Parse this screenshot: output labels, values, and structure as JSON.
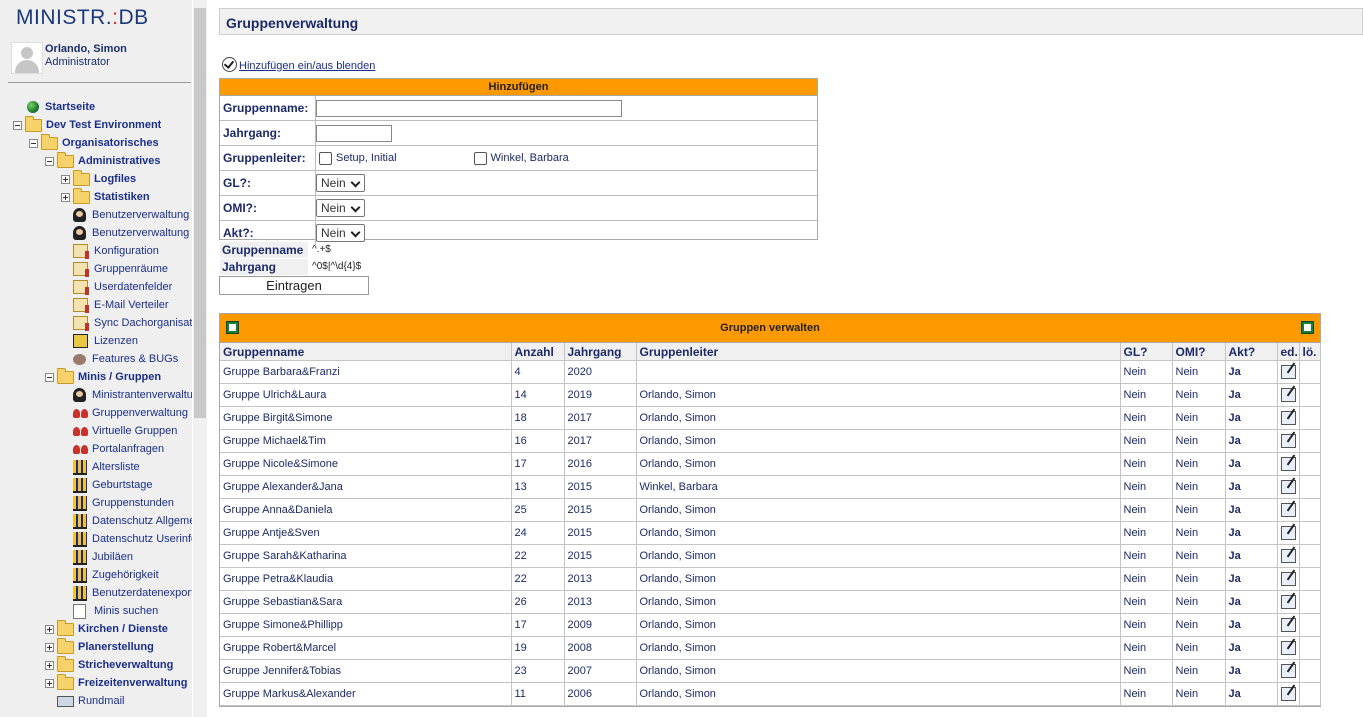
{
  "app": {
    "logo_text": "MINISTR.",
    "logo_accent": ":",
    "logo_suffix": "DB"
  },
  "user": {
    "name": "Orlando, Simon",
    "role": "Administrator"
  },
  "colors": {
    "accent": "#ff9900",
    "link": "#1a2f8a",
    "heading": "#1c2a6a"
  },
  "nav": [
    {
      "label": "Startseite",
      "indent": 0,
      "icon": "globe-icon",
      "bold": true,
      "expander": "none"
    },
    {
      "label": "Dev Test Environment",
      "indent": 0,
      "icon": "folder-icon",
      "bold": true,
      "expander": "minus"
    },
    {
      "label": "Organisatorisches",
      "indent": 1,
      "icon": "folder-icon",
      "bold": true,
      "expander": "minus"
    },
    {
      "label": "Administratives",
      "indent": 2,
      "icon": "folder-icon",
      "bold": true,
      "expander": "minus"
    },
    {
      "label": "Logfiles",
      "indent": 3,
      "icon": "folder-icon",
      "bold": true,
      "expander": "plus"
    },
    {
      "label": "Statistiken",
      "indent": 3,
      "icon": "folder-icon",
      "bold": true,
      "expander": "plus"
    },
    {
      "label": "Benutzerverwaltung",
      "indent": 3,
      "icon": "user-admin-icon",
      "bold": false,
      "expander": "none"
    },
    {
      "label": "Benutzerverwaltung",
      "indent": 3,
      "icon": "user-admin-icon",
      "bold": false,
      "expander": "none"
    },
    {
      "label": "Konfiguration",
      "indent": 3,
      "icon": "tools-icon",
      "bold": false,
      "expander": "none"
    },
    {
      "label": "Gruppenräume",
      "indent": 3,
      "icon": "tools-icon",
      "bold": false,
      "expander": "none"
    },
    {
      "label": "Userdatenfelder",
      "indent": 3,
      "icon": "tools-icon",
      "bold": false,
      "expander": "none"
    },
    {
      "label": "E-Mail Verteiler",
      "indent": 3,
      "icon": "tools-icon",
      "bold": false,
      "expander": "none"
    },
    {
      "label": "Sync Dachorganisation",
      "indent": 3,
      "icon": "tools-icon",
      "bold": false,
      "expander": "none"
    },
    {
      "label": "Lizenzen",
      "indent": 3,
      "icon": "key-icon",
      "bold": false,
      "expander": "none"
    },
    {
      "label": "Features & BUGs",
      "indent": 3,
      "icon": "bug-icon",
      "bold": false,
      "expander": "none"
    },
    {
      "label": "Minis / Gruppen",
      "indent": 2,
      "icon": "folder-icon",
      "bold": true,
      "expander": "minus"
    },
    {
      "label": "Ministrantenverwaltung",
      "indent": 3,
      "icon": "user-admin-icon",
      "bold": false,
      "expander": "none"
    },
    {
      "label": "Gruppenverwaltung",
      "indent": 3,
      "icon": "group-icon",
      "bold": false,
      "expander": "none"
    },
    {
      "label": "Virtuelle Gruppen",
      "indent": 3,
      "icon": "group-icon",
      "bold": false,
      "expander": "none"
    },
    {
      "label": "Portalanfragen",
      "indent": 3,
      "icon": "group-icon",
      "bold": false,
      "expander": "none"
    },
    {
      "label": "Altersliste",
      "indent": 3,
      "icon": "chart-icon",
      "bold": false,
      "expander": "none"
    },
    {
      "label": "Geburtstage",
      "indent": 3,
      "icon": "chart-icon",
      "bold": false,
      "expander": "none"
    },
    {
      "label": "Gruppenstunden",
      "indent": 3,
      "icon": "chart-icon",
      "bold": false,
      "expander": "none"
    },
    {
      "label": "Datenschutz Allgemein",
      "indent": 3,
      "icon": "chart-icon",
      "bold": false,
      "expander": "none"
    },
    {
      "label": "Datenschutz Userinfo",
      "indent": 3,
      "icon": "chart-icon",
      "bold": false,
      "expander": "none"
    },
    {
      "label": "Jubiläen",
      "indent": 3,
      "icon": "chart-icon",
      "bold": false,
      "expander": "none"
    },
    {
      "label": "Zugehörigkeit",
      "indent": 3,
      "icon": "chart-icon",
      "bold": false,
      "expander": "none"
    },
    {
      "label": "Benutzerdatenexport",
      "indent": 3,
      "icon": "chart-icon",
      "bold": false,
      "expander": "none"
    },
    {
      "label": "Minis suchen",
      "indent": 3,
      "icon": "search-doc-icon",
      "bold": false,
      "expander": "none"
    },
    {
      "label": "Kirchen / Dienste",
      "indent": 2,
      "icon": "folder-icon",
      "bold": true,
      "expander": "plus"
    },
    {
      "label": "Planerstellung",
      "indent": 2,
      "icon": "folder-icon",
      "bold": true,
      "expander": "plus"
    },
    {
      "label": "Stricheverwaltung",
      "indent": 2,
      "icon": "folder-icon",
      "bold": true,
      "expander": "plus"
    },
    {
      "label": "Freizeitenverwaltung",
      "indent": 2,
      "icon": "folder-icon",
      "bold": true,
      "expander": "plus"
    },
    {
      "label": "Rundmail",
      "indent": 2,
      "icon": "mail-icon",
      "bold": false,
      "expander": "none"
    }
  ],
  "page": {
    "title": "Gruppenverwaltung",
    "toggle_link": "Hinzufügen ein/aus blenden"
  },
  "add_form": {
    "header": "Hinzufügen",
    "fields": {
      "gruppenname": {
        "label": "Gruppenname:",
        "value": ""
      },
      "jahrgang": {
        "label": "Jahrgang:",
        "value": ""
      },
      "gruppenleiter": {
        "label": "Gruppenleiter:",
        "options": [
          "Setup, Initial",
          "Winkel, Barbara"
        ]
      },
      "gl": {
        "label": "GL?:",
        "value": "Nein"
      },
      "omi": {
        "label": "OMI?:",
        "value": "Nein"
      },
      "akt": {
        "label": "Akt?:",
        "value": "Nein"
      }
    },
    "hints": [
      {
        "label": "Gruppenname",
        "pattern": "^.+$"
      },
      {
        "label": "Jahrgang",
        "pattern": "^0$|^\\d{4}$"
      }
    ],
    "submit_label": "Eintragen"
  },
  "groups_table": {
    "title": "Gruppen verwalten",
    "columns": [
      "Gruppenname",
      "Anzahl",
      "Jahrgang",
      "Gruppenleiter",
      "GL?",
      "OMI?",
      "Akt?",
      "ed.",
      "lö."
    ],
    "rows": [
      [
        "Gruppe Barbara&Franzi",
        "4",
        "2020",
        "",
        "Nein",
        "Nein",
        "Ja"
      ],
      [
        "Gruppe Ulrich&Laura",
        "14",
        "2019",
        "Orlando, Simon",
        "Nein",
        "Nein",
        "Ja"
      ],
      [
        "Gruppe Birgit&Simone",
        "18",
        "2017",
        "Orlando, Simon",
        "Nein",
        "Nein",
        "Ja"
      ],
      [
        "Gruppe Michael&Tim",
        "16",
        "2017",
        "Orlando, Simon",
        "Nein",
        "Nein",
        "Ja"
      ],
      [
        "Gruppe Nicole&Simone",
        "17",
        "2016",
        "Orlando, Simon",
        "Nein",
        "Nein",
        "Ja"
      ],
      [
        "Gruppe Alexander&Jana",
        "13",
        "2015",
        "Winkel, Barbara",
        "Nein",
        "Nein",
        "Ja"
      ],
      [
        "Gruppe Anna&Daniela",
        "25",
        "2015",
        "Orlando, Simon",
        "Nein",
        "Nein",
        "Ja"
      ],
      [
        "Gruppe Antje&Sven",
        "24",
        "2015",
        "Orlando, Simon",
        "Nein",
        "Nein",
        "Ja"
      ],
      [
        "Gruppe Sarah&Katharina",
        "22",
        "2015",
        "Orlando, Simon",
        "Nein",
        "Nein",
        "Ja"
      ],
      [
        "Gruppe Petra&Klaudia",
        "22",
        "2013",
        "Orlando, Simon",
        "Nein",
        "Nein",
        "Ja"
      ],
      [
        "Gruppe Sebastian&Sara",
        "26",
        "2013",
        "Orlando, Simon",
        "Nein",
        "Nein",
        "Ja"
      ],
      [
        "Gruppe Simone&Phillipp",
        "17",
        "2009",
        "Orlando, Simon",
        "Nein",
        "Nein",
        "Ja"
      ],
      [
        "Gruppe Robert&Marcel",
        "19",
        "2008",
        "Orlando, Simon",
        "Nein",
        "Nein",
        "Ja"
      ],
      [
        "Gruppe Jennifer&Tobias",
        "23",
        "2007",
        "Orlando, Simon",
        "Nein",
        "Nein",
        "Ja"
      ],
      [
        "Gruppe Markus&Alexander",
        "11",
        "2006",
        "Orlando, Simon",
        "Nein",
        "Nein",
        "Ja"
      ]
    ]
  }
}
